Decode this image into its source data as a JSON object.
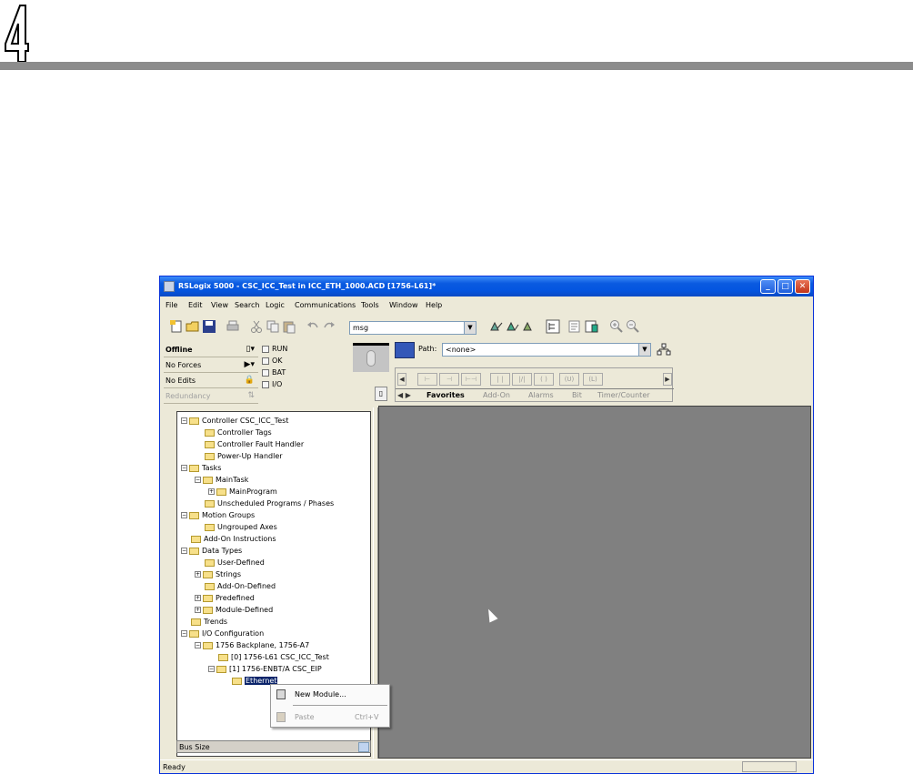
{
  "page": {
    "chapter_number": "4",
    "colors": {
      "rule": "#8c8c8c",
      "titlebar": "#0a5ae0",
      "workspace": "#808080",
      "selection": "#0a246a"
    }
  },
  "window": {
    "title": "RSLogix 5000 - CSC_ICC_Test in ICC_ETH_1000.ACD [1756-L61]*",
    "buttons": {
      "minimize": "_",
      "maximize": "□",
      "close": "✕"
    }
  },
  "menu": [
    "File",
    "Edit",
    "View",
    "Search",
    "Logic",
    "Communications",
    "Tools",
    "Window",
    "Help"
  ],
  "toolbar": {
    "search_value": "msg",
    "icons": [
      "new-icon",
      "open-icon",
      "save-icon",
      "print-icon",
      "cut-icon",
      "copy-icon",
      "paste-icon",
      "undo-icon",
      "redo-icon"
    ]
  },
  "status": {
    "rows": [
      "Offline",
      "No Forces",
      "No Edits",
      "Redundancy"
    ],
    "indicators": [
      "RUN",
      "OK",
      "BAT",
      "I/O"
    ]
  },
  "path": {
    "label": "Path:",
    "value": "<none>"
  },
  "instructions": {
    "buttons": [
      "⊢",
      "⊣",
      "⊢⊣",
      "| |",
      "|/|",
      "( )",
      "(U)",
      "(L)"
    ],
    "tabs": [
      "Favorites",
      "Add-On",
      "Alarms",
      "Bit",
      "Timer/Counter"
    ]
  },
  "tree": [
    {
      "label": "Controller CSC_ICC_Test",
      "depth": 0,
      "expander": "−"
    },
    {
      "label": "Controller Tags",
      "depth": 1
    },
    {
      "label": "Controller Fault Handler",
      "depth": 1
    },
    {
      "label": "Power-Up Handler",
      "depth": 1
    },
    {
      "label": "Tasks",
      "depth": 0,
      "expander": "−"
    },
    {
      "label": "MainTask",
      "depth": 1,
      "expander": "−"
    },
    {
      "label": "MainProgram",
      "depth": 2,
      "expander": "+"
    },
    {
      "label": "Unscheduled Programs / Phases",
      "depth": 1
    },
    {
      "label": "Motion Groups",
      "depth": 0,
      "expander": "−"
    },
    {
      "label": "Ungrouped Axes",
      "depth": 1
    },
    {
      "label": "Add-On Instructions",
      "depth": 0
    },
    {
      "label": "Data Types",
      "depth": 0,
      "expander": "−"
    },
    {
      "label": "User-Defined",
      "depth": 1
    },
    {
      "label": "Strings",
      "depth": 1,
      "expander": "+"
    },
    {
      "label": "Add-On-Defined",
      "depth": 1
    },
    {
      "label": "Predefined",
      "depth": 1,
      "expander": "+"
    },
    {
      "label": "Module-Defined",
      "depth": 1,
      "expander": "+"
    },
    {
      "label": "Trends",
      "depth": 0
    },
    {
      "label": "I/O Configuration",
      "depth": 0,
      "expander": "−"
    },
    {
      "label": "1756 Backplane, 1756-A7",
      "depth": 1,
      "expander": "−"
    },
    {
      "label": "[0] 1756-L61 CSC_ICC_Test",
      "depth": 2
    },
    {
      "label": "[1] 1756-ENBT/A CSC_EIP",
      "depth": 2,
      "expander": "−"
    },
    {
      "label": "Ethernet",
      "depth": 3,
      "selected": true
    }
  ],
  "bus_size_label": "Bus Size",
  "context_menu": {
    "items": [
      {
        "label": "New Module...",
        "shortcut": "",
        "enabled": true
      },
      {
        "label": "Paste",
        "shortcut": "Ctrl+V",
        "enabled": false
      }
    ]
  },
  "statusbar": {
    "text": "Ready"
  }
}
